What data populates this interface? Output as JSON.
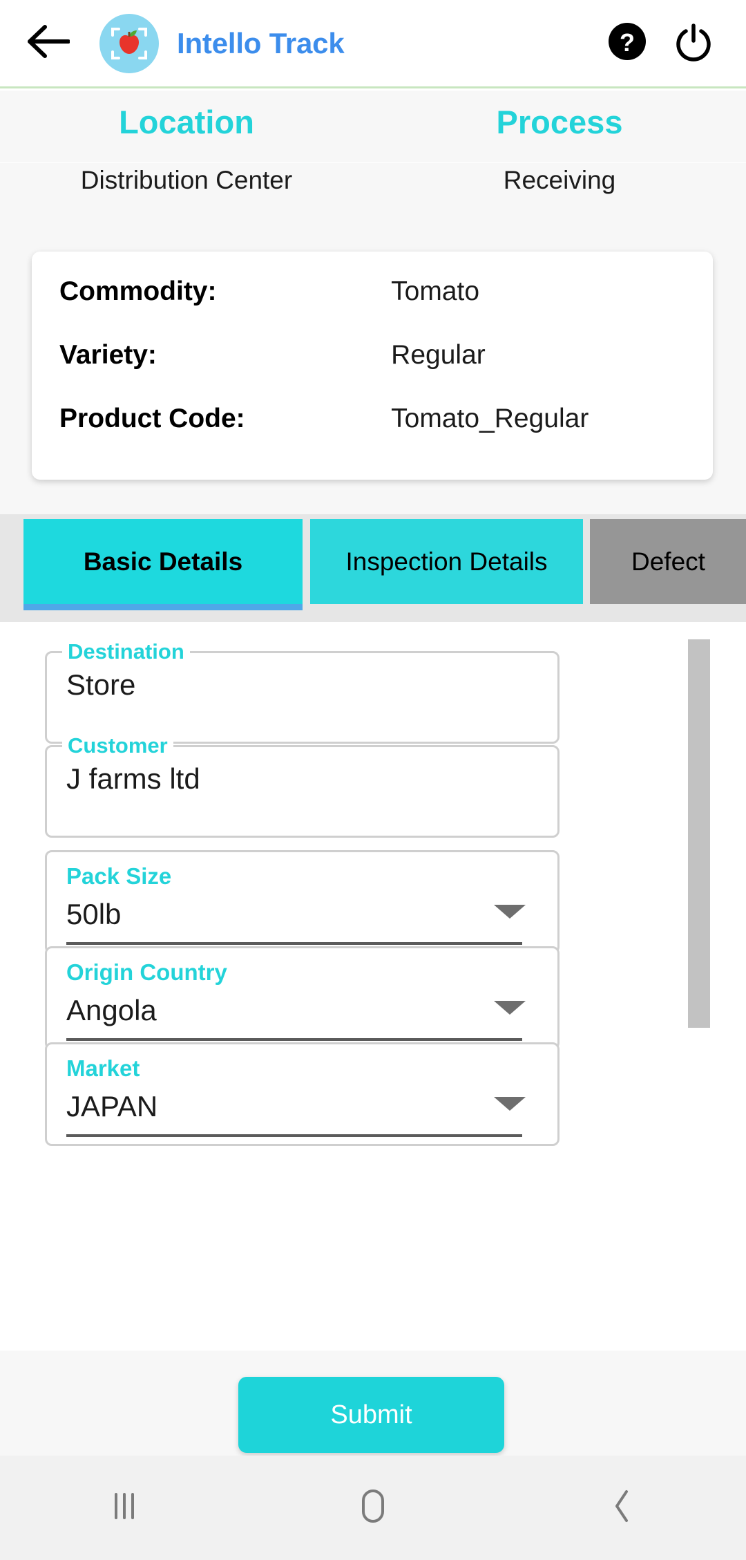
{
  "appbar": {
    "back_icon": "arrow-left-icon",
    "logo_icon": "apple-scan-logo-icon",
    "title": "Intello Track",
    "help_icon": "help-circle-icon",
    "power_icon": "power-icon"
  },
  "context": {
    "location_heading": "Location",
    "location_value": "Distribution Center",
    "process_heading": "Process",
    "process_value": "Receiving"
  },
  "product_card": {
    "rows": [
      {
        "label": "Commodity:",
        "value": "Tomato"
      },
      {
        "label": "Variety:",
        "value": "Regular"
      },
      {
        "label": "Product Code:",
        "value": "Tomato_Regular"
      }
    ]
  },
  "tabs": [
    {
      "label": "Basic Details",
      "state": "active"
    },
    {
      "label": "Inspection Details",
      "state": "inactive"
    },
    {
      "label": "Defect",
      "state": "disabled"
    }
  ],
  "form": {
    "fields": [
      {
        "label": "Destination",
        "value": "Store",
        "type": "text"
      },
      {
        "label": "Customer",
        "value": "J farms ltd",
        "type": "text"
      },
      {
        "label": "Pack Size",
        "value": "50lb",
        "type": "dropdown"
      },
      {
        "label": "Origin Country",
        "value": "Angola",
        "type": "dropdown"
      },
      {
        "label": "Market",
        "value": "JAPAN",
        "type": "dropdown"
      }
    ],
    "scrollbar": "vertical-scrollbar"
  },
  "actions": {
    "submit_label": "Submit"
  },
  "navbar": {
    "recents_icon": "recents-icon",
    "home_icon": "home-icon",
    "back_icon": "back-chevron-icon"
  },
  "colors": {
    "accent_cyan": "#23D3D9",
    "brand_blue": "#3C8DEC",
    "tab_active": "#1ED9DE",
    "tab_indicator": "#4FA8E8",
    "tab_disabled": "#969696"
  }
}
